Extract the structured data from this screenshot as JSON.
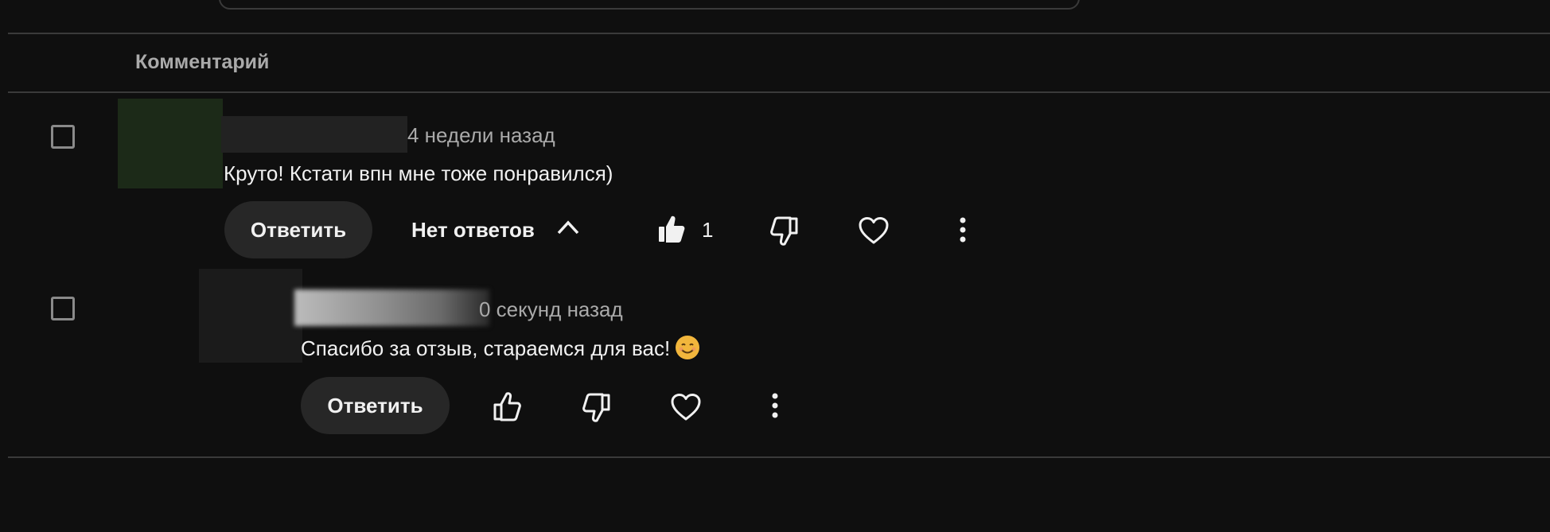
{
  "header": {
    "column_label": "Комментарий"
  },
  "comments": [
    {
      "time": "4 недели назад",
      "text": "Круто! Кстати впн мне тоже понравился)",
      "reply_label": "Ответить",
      "replies_toggle_label": "Нет ответов",
      "like_count": "1",
      "icons": [
        "thumbs-up-filled-icon",
        "thumbs-down-icon",
        "heart-icon",
        "more-vertical-icon"
      ]
    },
    {
      "time": "0 секунд назад",
      "text": "Спасибо за отзыв, стараемся для вас!",
      "emoji": "smiling-face-emoji",
      "reply_label": "Ответить",
      "icons": [
        "thumbs-up-icon",
        "thumbs-down-icon",
        "heart-icon",
        "more-vertical-icon"
      ]
    }
  ],
  "colors": {
    "background": "#0f0f0f",
    "divider": "#3a3a3a",
    "button_bg": "#272727",
    "secondary_text": "#aaaaaa",
    "primary_text": "#f1f1f1"
  }
}
